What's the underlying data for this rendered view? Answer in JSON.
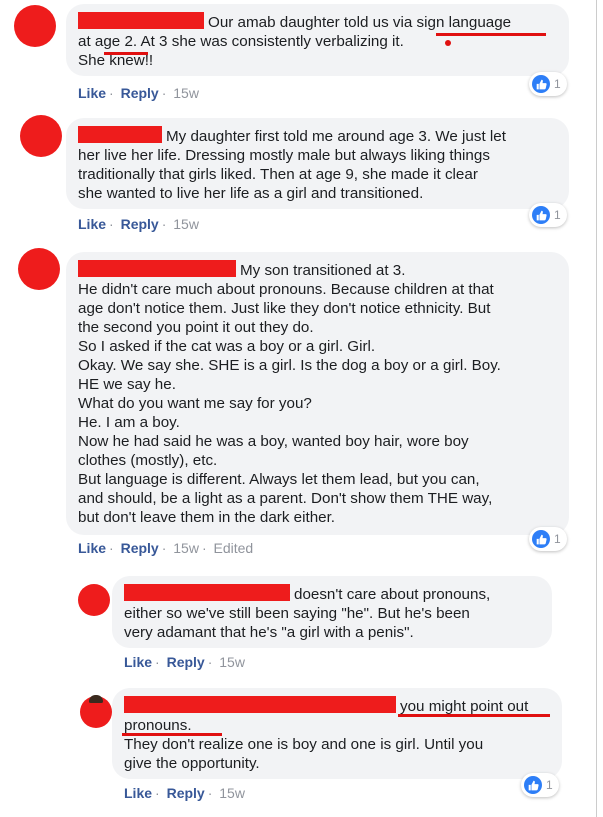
{
  "comments": [
    {
      "lines": [
        "Our amab daughter told us via sign language",
        "at age 2. At 3 she was consistently verbalizing it.",
        "She knew!!"
      ],
      "actions": {
        "like": "Like",
        "reply": "Reply",
        "time": "15w"
      },
      "reactions": {
        "count": "1",
        "icon": "like-icon"
      }
    },
    {
      "lines": [
        "My daughter first told me around age 3. We just let",
        "her live her life. Dressing mostly male but always liking things",
        "traditionally that girls liked. Then at age 9, she made it clear",
        "she wanted to live her life as a girl and transitioned."
      ],
      "actions": {
        "like": "Like",
        "reply": "Reply",
        "time": "15w"
      },
      "reactions": {
        "count": "1",
        "icon": "like-icon"
      }
    },
    {
      "lines": [
        "My son transitioned at 3.",
        "He didn't care much about pronouns. Because children at that",
        "age don't notice them. Just like they don't notice ethnicity. But",
        "the second you point it out they do.",
        "So I asked if the cat was a boy or a girl. Girl.",
        "Okay. We say she. SHE is a girl. Is the dog a boy or a girl. Boy.",
        "HE we say he.",
        "What do you want me say for you?",
        "He. I am a boy.",
        "Now he had said he was a boy, wanted boy hair, wore boy",
        "clothes (mostly), etc.",
        "But language is different. Always let them lead, but you can,",
        "and should, be a light as a parent. Don't show them THE way,",
        "but don't leave them in the dark either."
      ],
      "actions": {
        "like": "Like",
        "reply": "Reply",
        "time": "15w",
        "edited": "Edited"
      },
      "reactions": {
        "count": "1",
        "icon": "like-icon"
      }
    },
    {
      "lines": [
        "doesn't care about pronouns,",
        "either so we've still been saying \"he\". But he's been",
        "very adamant that he's \"a girl with a penis\"."
      ],
      "actions": {
        "like": "Like",
        "reply": "Reply",
        "time": "15w"
      }
    },
    {
      "lines": [
        "you might point out",
        "pronouns.",
        "They don't realize one is boy and one is girl. Until you",
        "give the opportunity."
      ],
      "actions": {
        "like": "Like",
        "reply": "Reply",
        "time": "15w"
      },
      "reactions": {
        "count": "1",
        "icon": "like-icon"
      }
    }
  ],
  "colors": {
    "redaction": "#ee1c1c",
    "link": "#385898",
    "meta": "#90949c",
    "bubble": "#f2f3f5",
    "like": "#2d7ef7"
  }
}
